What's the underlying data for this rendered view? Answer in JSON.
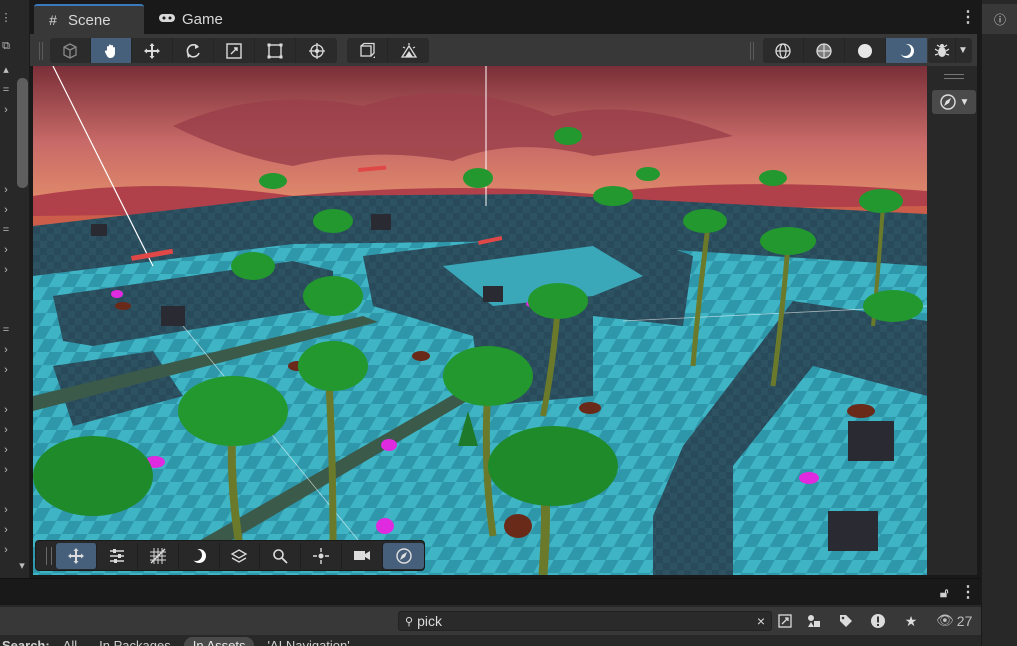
{
  "tabs": [
    {
      "label": "Scene",
      "icon": "grid-icon",
      "active": true
    },
    {
      "label": "Game",
      "icon": "gamepad-icon",
      "active": false
    }
  ],
  "toolbar": {
    "tools": [
      "view-hand",
      "move",
      "rotate",
      "scale",
      "rect",
      "transform"
    ],
    "active_tool": "view-hand",
    "shading_modes": [
      "wireframe",
      "shaded-wireframe",
      "shaded",
      "lit"
    ],
    "active_shading": "lit"
  },
  "overlay_toolbar": {
    "tools": [
      "move-tool",
      "snap-settings",
      "grid-toggle",
      "lighting-toggle",
      "layers",
      "search",
      "pivot",
      "camera",
      "compass"
    ],
    "active": [
      "move-tool",
      "compass"
    ]
  },
  "project": {
    "search": {
      "value": "pick",
      "placeholder": ""
    },
    "hidden_count": "27",
    "filter": {
      "label": "Search:",
      "options": [
        "All",
        "In Packages",
        "In Assets",
        "'AI Navigation'"
      ],
      "selected": "In Assets"
    }
  },
  "colors": {
    "accent": "#46607c",
    "tab_accent": "#3a79bb",
    "panel": "#383838",
    "dark": "#191919"
  }
}
